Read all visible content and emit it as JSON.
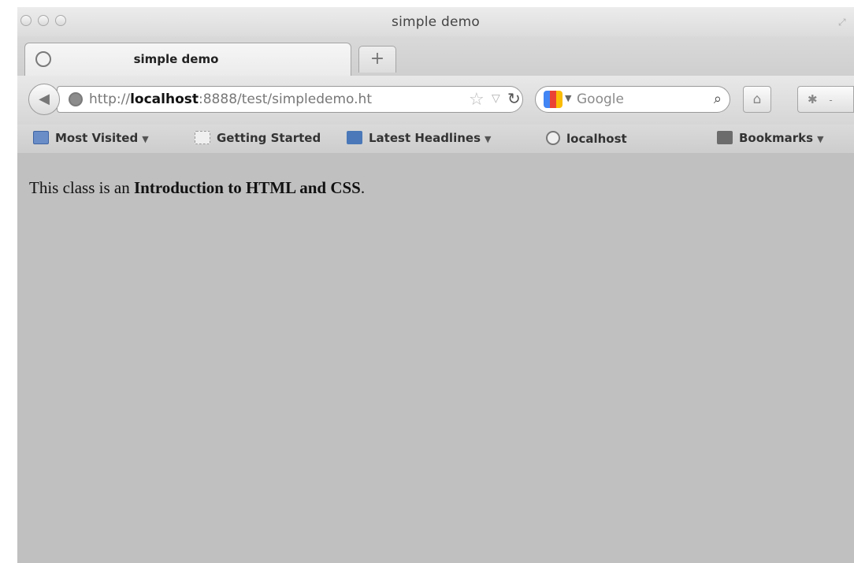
{
  "window": {
    "title": "simple demo"
  },
  "tabs": [
    {
      "label": "simple demo"
    }
  ],
  "new_tab_label": "+",
  "url": {
    "scheme": "http://",
    "host": "localhost",
    "rest": ":8888/test/simpledemo.ht"
  },
  "search": {
    "placeholder": "Google"
  },
  "bookmarks": [
    {
      "label": "Most Visited",
      "icon": "folder-icon",
      "has_menu": true
    },
    {
      "label": "Getting Started",
      "icon": "page-icon",
      "has_menu": false
    },
    {
      "label": "Latest Headlines",
      "icon": "rss-icon",
      "has_menu": true
    },
    {
      "label": "localhost",
      "icon": "globe-icon",
      "has_menu": false
    },
    {
      "label": "Bookmarks",
      "icon": "bookmarks-icon",
      "has_menu": true
    }
  ],
  "page": {
    "intro": "This class is an ",
    "bold": "Introduction to HTML and CSS",
    "end": "."
  }
}
